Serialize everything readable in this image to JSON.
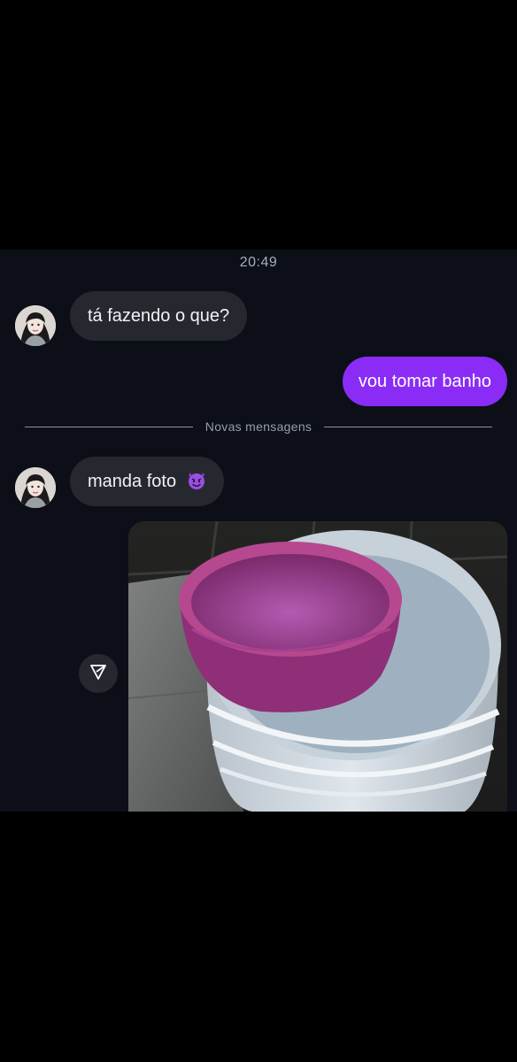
{
  "chat": {
    "timestamp": "20:49",
    "messages": [
      {
        "direction": "incoming",
        "text": "tá fazendo o que?"
      },
      {
        "direction": "outgoing",
        "text": "vou tomar banho"
      },
      {
        "direction": "incoming",
        "text": "manda foto",
        "emoji": "smiling-devil-emoji"
      }
    ],
    "new_messages_label": "Novas mensagens",
    "photo": {
      "subject": "pink-basin-on-stacked-white-buckets"
    },
    "share_icon": "paper-plane-icon"
  },
  "colors": {
    "background": "#0c0f17",
    "incoming_bubble": "#262830",
    "outgoing_bubble": "#8a2cf6",
    "muted_text": "#a9adb6"
  }
}
